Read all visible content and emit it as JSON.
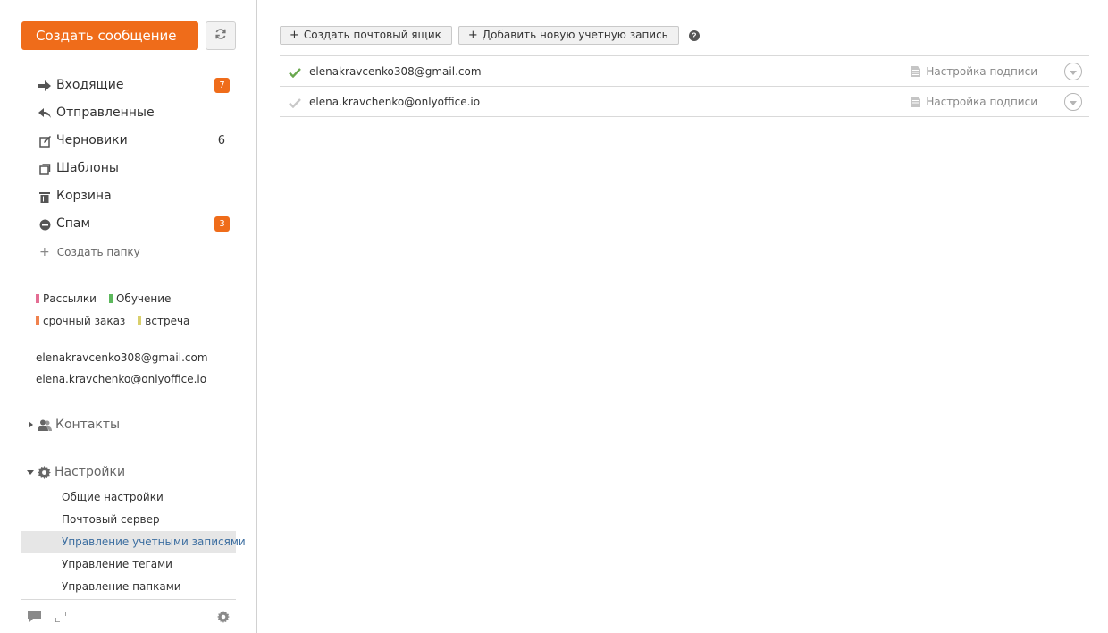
{
  "sidebar": {
    "compose_label": "Создать сообщение",
    "folders": [
      {
        "label": "Входящие",
        "badge": "7",
        "icon": "arrow-right-icon"
      },
      {
        "label": "Отправленные",
        "icon": "reply-icon"
      },
      {
        "label": "Черновики",
        "count": "6",
        "icon": "edit-icon"
      },
      {
        "label": "Шаблоны",
        "icon": "templates-icon"
      },
      {
        "label": "Корзина",
        "icon": "trash-icon"
      },
      {
        "label": "Спам",
        "badge": "3",
        "icon": "spam-icon"
      }
    ],
    "create_folder_label": "Создать папку",
    "tags": [
      {
        "label": "Рассылки",
        "color": "#e46d93"
      },
      {
        "label": "Обучение",
        "color": "#5cb85c"
      },
      {
        "label": "срочный заказ",
        "color": "#f0824e"
      },
      {
        "label": "встреча",
        "color": "#d9cf6b"
      }
    ],
    "accounts": [
      "elenakravcenko308@gmail.com",
      "elena.kravchenko@onlyoffice.io"
    ],
    "contacts_label": "Контакты",
    "settings_label": "Настройки",
    "settings_items": [
      "Общие настройки",
      "Почтовый сервер",
      "Управление учетными записями",
      "Управление тегами",
      "Управление папками"
    ]
  },
  "toolbar": {
    "create_mailbox_label": "Создать почтовый ящик",
    "add_account_label": "Добавить новую учетную запись",
    "help_glyph": "?"
  },
  "account_rows": [
    {
      "email": "elenakravcenko308@gmail.com",
      "signature_label": "Настройка подписи",
      "default": true
    },
    {
      "email": "elena.kravchenko@onlyoffice.io",
      "signature_label": "Настройка подписи",
      "default": false
    }
  ],
  "colors": {
    "accent": "#ef6c1a",
    "check_active": "#6aa84f",
    "check_inactive": "#c8c8c8",
    "active_link": "#3c6ea0"
  }
}
